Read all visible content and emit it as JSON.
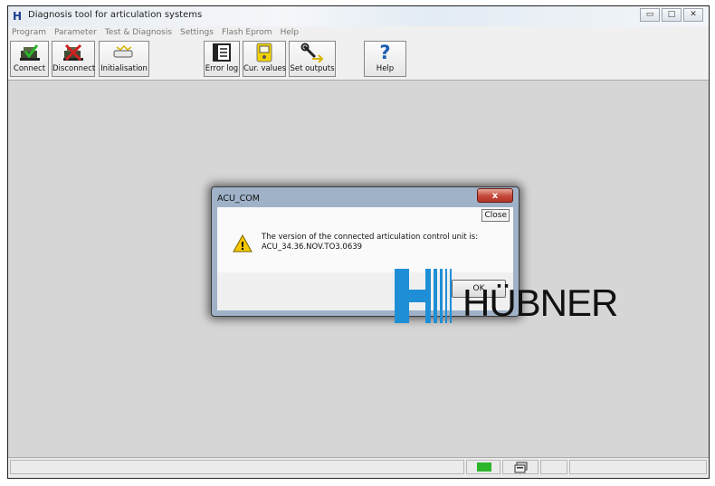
{
  "window": {
    "title": "Diagnosis tool for articulation systems",
    "logo_text": "H",
    "controls": {
      "minimize": "▭",
      "maximize": "□",
      "close": "✕"
    }
  },
  "menu": [
    "Program",
    "Parameter",
    "Test & Diagnosis",
    "Settings",
    "Flash Eprom",
    "Help"
  ],
  "toolbar": [
    {
      "label": "Connect",
      "icon": "connect-icon"
    },
    {
      "label": "Disconnect",
      "icon": "disconnect-icon"
    },
    {
      "label": "Initialisation",
      "icon": "initialisation-icon"
    },
    {
      "label": "Error log",
      "icon": "error-log-icon"
    },
    {
      "label": "Cur. values",
      "icon": "current-values-icon"
    },
    {
      "label": "Set outputs",
      "icon": "set-outputs-icon"
    },
    {
      "label": "Help",
      "icon": "help-icon",
      "glyph": "?"
    }
  ],
  "dialog": {
    "title": "ACU_COM",
    "close_glyph": "x",
    "close_label": "Close",
    "message_line1": "The version of the connected articulation control unit is:",
    "message_line2": "ACU_34.36.NOV.TO3.0639",
    "ok_label": "OK",
    "icon": "warning-icon",
    "warning_glyph": "!"
  },
  "brand": {
    "name": "HÜBNER",
    "color": "#1e8fd6"
  },
  "colors": {
    "connect_status": "#2bb52b"
  }
}
